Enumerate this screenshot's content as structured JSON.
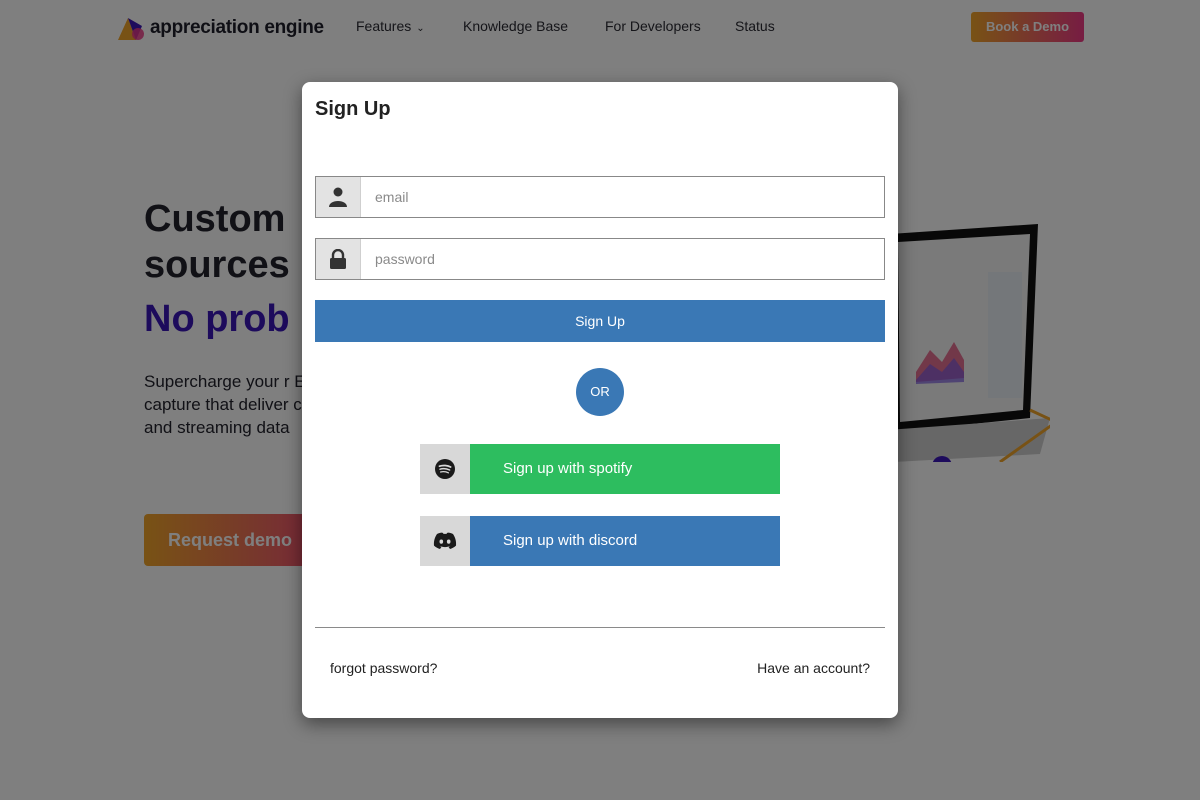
{
  "nav": {
    "brand": "appreciation engine",
    "items": [
      {
        "label": "Features",
        "has_dropdown": true
      },
      {
        "label": "Knowledge Base"
      },
      {
        "label": "For Developers"
      },
      {
        "label": "Status"
      }
    ],
    "cta": "Book a Demo"
  },
  "hero": {
    "line1": "Custom",
    "line2": "sources",
    "line3": "No prob",
    "paragraph": "Supercharge your r Engine’s privacy co capture that deliver customer insights fr and streaming data",
    "cta": "Request demo"
  },
  "modal": {
    "title": "Sign Up",
    "email_placeholder": "email",
    "password_placeholder": "password",
    "submit_label": "Sign Up",
    "or_label": "OR",
    "spotify_label": "Sign up with spotify",
    "discord_label": "Sign up with discord",
    "forgot_label": "forgot password?",
    "have_account_label": "Have an account?"
  },
  "icons": {
    "email": "user-icon",
    "password": "lock-icon",
    "spotify": "spotify-icon",
    "discord": "discord-icon"
  },
  "colors": {
    "primary": "#3a78b5",
    "spotify": "#2dbd5f",
    "accent_gradient_start": "#f0a52a",
    "accent_gradient_end": "#ee3a86",
    "hero_purple": "#3a16b8"
  }
}
